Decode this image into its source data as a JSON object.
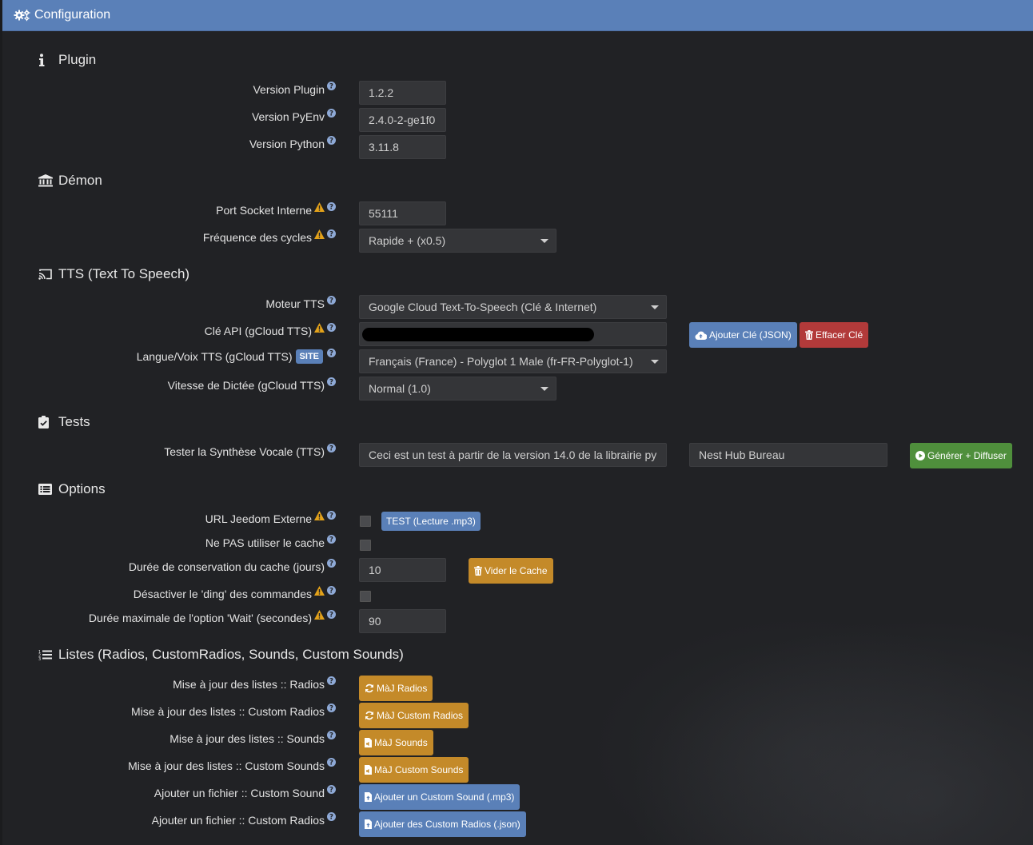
{
  "header": {
    "title": "Configuration",
    "icon": "cogs-icon"
  },
  "colors": {
    "header_bg": "#5a80b8",
    "panel_bg": "#212225",
    "input_bg": "#343538",
    "btn_blue": "#5a80b8",
    "btn_red": "#b23a3a",
    "btn_green": "#4f8f3c",
    "btn_orange": "#c48a29"
  },
  "sections": {
    "plugin": {
      "title": "Plugin",
      "icon": "info-icon"
    },
    "demon": {
      "title": "Démon",
      "icon": "bank-icon"
    },
    "tts": {
      "title": "TTS (Text To Speech)",
      "icon": "cast-icon"
    },
    "tests": {
      "title": "Tests",
      "icon": "clipboard-check-icon"
    },
    "options": {
      "title": "Options",
      "icon": "list-alt-icon"
    },
    "listes": {
      "title": "Listes (Radios, CustomRadios, Sounds, Custom Sounds)",
      "icon": "list-ol-icon"
    }
  },
  "plugin": {
    "version_plugin": {
      "label": "Version Plugin",
      "value": "1.2.2"
    },
    "version_pyenv": {
      "label": "Version PyEnv",
      "value": "2.4.0-2-ge1f0"
    },
    "version_python": {
      "label": "Version Python",
      "value": "3.11.8"
    }
  },
  "demon": {
    "port": {
      "label": "Port Socket Interne",
      "value": "55111"
    },
    "frequence": {
      "label": "Fréquence des cycles",
      "value": "Rapide + (x0.5)"
    }
  },
  "tts": {
    "moteur": {
      "label": "Moteur TTS",
      "value": "Google Cloud Text-To-Speech (Clé & Internet)"
    },
    "cle_api": {
      "label": "Clé API (gCloud TTS)",
      "add_label": "Ajouter Clé (JSON)",
      "clear_label": "Effacer Clé"
    },
    "langue": {
      "label": "Langue/Voix TTS (gCloud TTS)",
      "badge": "SITE",
      "value": "Français (France) - Polyglot 1 Male (fr-FR-Polyglot-1)"
    },
    "vitesse": {
      "label": "Vitesse de Dictée (gCloud TTS)",
      "value": "Normal (1.0)"
    }
  },
  "tests": {
    "tester": {
      "label": "Tester la Synthèse Vocale (TTS)",
      "text_value": "Ceci est un test à partir de la version 14.0 de la librairie py",
      "device_value": "Nest Hub Bureau",
      "button_label": "Générer + Diffuser"
    }
  },
  "options": {
    "url_externe": {
      "label": "URL Jeedom Externe",
      "button_label": "TEST (Lecture .mp3)"
    },
    "no_cache": {
      "label": "Ne PAS utiliser le cache"
    },
    "duree_cache": {
      "label": "Durée de conservation du cache (jours)",
      "value": "10",
      "button_label": "Vider le Cache"
    },
    "ding": {
      "label": "Désactiver le 'ding' des commandes"
    },
    "wait": {
      "label": "Durée maximale de l'option 'Wait' (secondes)",
      "value": "90"
    }
  },
  "listes": {
    "radios": {
      "label": "Mise à jour des listes :: Radios",
      "button_label": "MàJ Radios"
    },
    "custom_radios": {
      "label": "Mise à jour des listes :: Custom Radios",
      "button_label": "MàJ Custom Radios"
    },
    "sounds": {
      "label": "Mise à jour des listes :: Sounds",
      "button_label": "MàJ Sounds"
    },
    "custom_sounds": {
      "label": "Mise à jour des listes :: Custom Sounds",
      "button_label": "MàJ Custom Sounds"
    },
    "add_sound": {
      "label": "Ajouter un fichier :: Custom Sound",
      "button_label": "Ajouter un Custom Sound (.mp3)"
    },
    "add_radios": {
      "label": "Ajouter un fichier :: Custom Radios",
      "button_label": "Ajouter des Custom Radios (.json)"
    }
  }
}
